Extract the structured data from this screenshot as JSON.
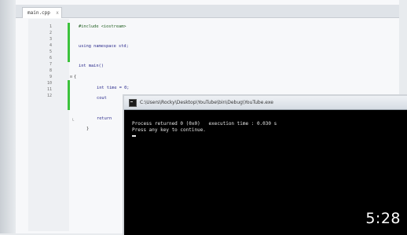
{
  "tab": {
    "label": "main.cpp",
    "close_glyph": "x"
  },
  "editor": {
    "line_numbers": [
      "1",
      "2",
      "3",
      "4",
      "5",
      "6",
      "7",
      "8",
      "9",
      "10",
      "11",
      "12"
    ],
    "code_lines": [
      {
        "text": "#include <iostream>",
        "style": "comment"
      },
      {
        "text": "using namespace std;",
        "style": "keyword"
      },
      {
        "text": "int main()",
        "style": "keyword"
      },
      {
        "text": "{",
        "style": "plain"
      },
      {
        "text": "int time = 0;",
        "style": "keyword"
      },
      {
        "text": "cout",
        "style": "keyword"
      },
      {
        "text": "return",
        "style": "keyword"
      },
      {
        "text": "}",
        "style": "plain"
      }
    ]
  },
  "console": {
    "title": "C:\\Users\\Rocky\\Desktop\\YouTube\\bin\\Debug\\YouTube.exe",
    "line1": "Process returned 0 (0x0)   execution time : 0.030 s",
    "line2": "Press any key to continue."
  },
  "video": {
    "duration": "5:28"
  },
  "colors": {
    "change_bar": "#3cc23c",
    "console_bg": "#000000",
    "code_comment": "#1d5c1d",
    "code_keyword": "#2a2a8c"
  }
}
